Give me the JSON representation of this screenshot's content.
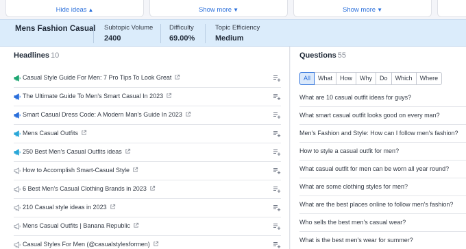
{
  "top_links": {
    "hide_ideas": "Hide ideas",
    "show_more_1": "Show more",
    "show_more_2": "Show more"
  },
  "summary": {
    "title": "Mens Fashion Casual",
    "subtopic_volume": {
      "label": "Subtopic Volume",
      "value": "2400"
    },
    "difficulty": {
      "label": "Difficulty",
      "value": "69.00%"
    },
    "topic_efficiency": {
      "label": "Topic Efficiency",
      "value": "Medium"
    }
  },
  "headlines": {
    "title": "Headlines",
    "count": "10",
    "items": [
      {
        "text": "Casual Style Guide For Men: 7 Pro Tips To Look Great",
        "level": "high",
        "color": "#1ea672"
      },
      {
        "text": "The Ultimate Guide To Men's Smart Casual In 2023",
        "level": "high",
        "color": "#2a6fdb"
      },
      {
        "text": "Smart Casual Dress Code: A Modern Man's Guide In 2023",
        "level": "high",
        "color": "#2a6fdb"
      },
      {
        "text": "Mens Casual Outfits",
        "level": "medium",
        "color": "#2aa7d8"
      },
      {
        "text": "250 Best Men's Casual Outfits ideas",
        "level": "medium",
        "color": "#2aa7d8"
      },
      {
        "text": "How to Accomplish Smart-Casual Style",
        "level": "low",
        "color": "#9aa0ab"
      },
      {
        "text": "6 Best Men's Casual Clothing Brands in 2023",
        "level": "low",
        "color": "#9aa0ab"
      },
      {
        "text": "210 Casual style ideas in 2023",
        "level": "low",
        "color": "#9aa0ab"
      },
      {
        "text": "Mens Casual Outfits | Banana Republic",
        "level": "low",
        "color": "#9aa0ab"
      },
      {
        "text": "Casual Styles For Men (@casualstylesformen)",
        "level": "low",
        "color": "#9aa0ab"
      }
    ]
  },
  "questions": {
    "title": "Questions",
    "count": "55",
    "tabs": [
      "All",
      "What",
      "How",
      "Why",
      "Do",
      "Which",
      "Where"
    ],
    "active_tab": "All",
    "items": [
      "What are 10 casual outfit ideas for guys?",
      "What smart casual outfit looks good on every man?",
      "Men's Fashion and Style: How can I follow men's fashion?",
      "How to style a casual outfit for men?",
      "What casual outfit for men can be worn all year round?",
      "What are some clothing styles for men?",
      "What are the best places online to follow men's fashion?",
      "Who sells the best men's casual wear?",
      "What is the best men's wear for summer?"
    ]
  },
  "colors": {
    "accent": "#2a6fdb",
    "summary_bg": "#dbecfb"
  }
}
